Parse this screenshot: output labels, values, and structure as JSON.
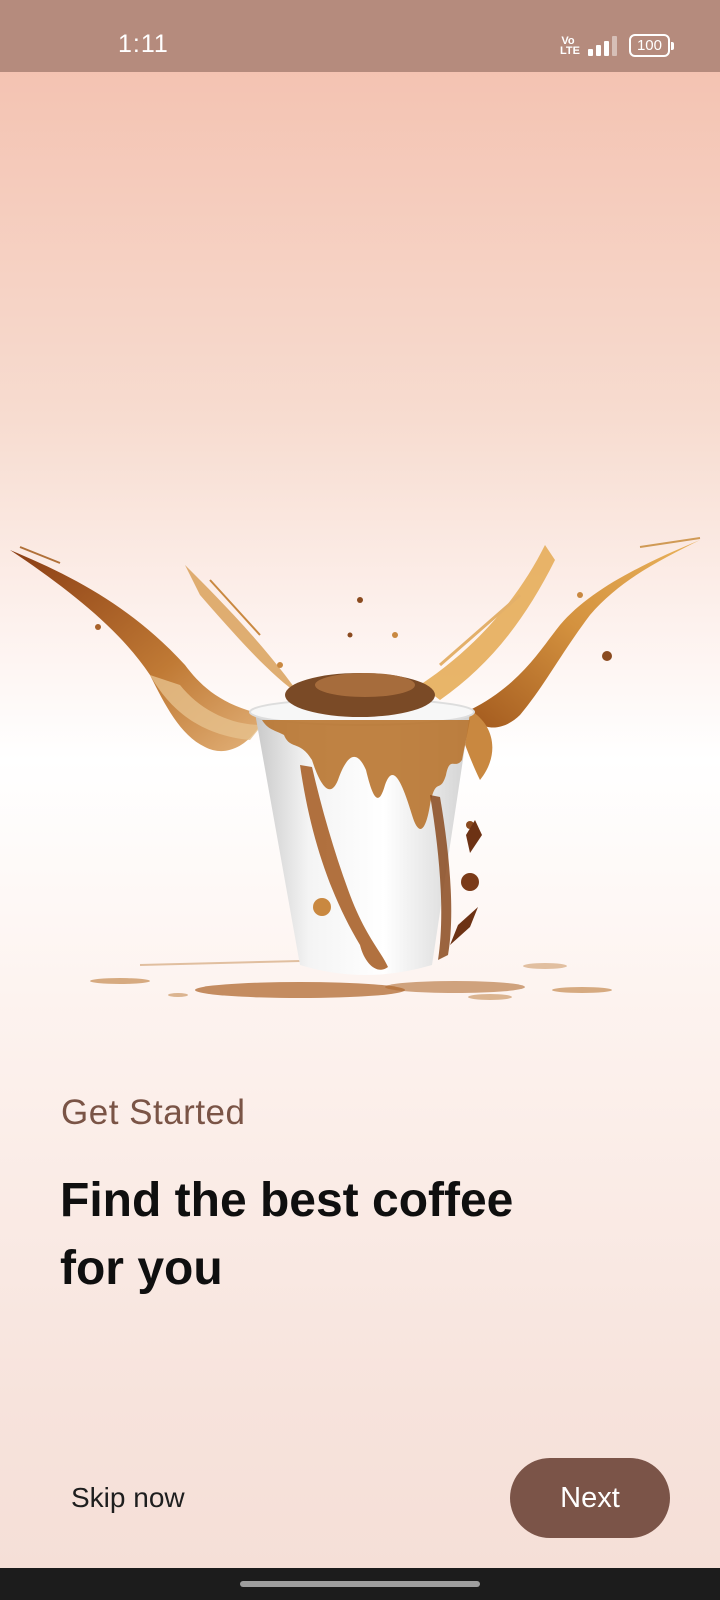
{
  "status_bar": {
    "time": "1:11",
    "network": "Vo LTE",
    "battery": "100"
  },
  "onboarding": {
    "hero_image": "coffee-cup-splash",
    "subtitle": "Get Started",
    "headline": "Find the best coffee for you"
  },
  "actions": {
    "skip_label": "Skip now",
    "next_label": "Next"
  },
  "colors": {
    "accent": "#7b5448",
    "subtitle": "#7a5446",
    "status_bar": "#b58b7d"
  }
}
